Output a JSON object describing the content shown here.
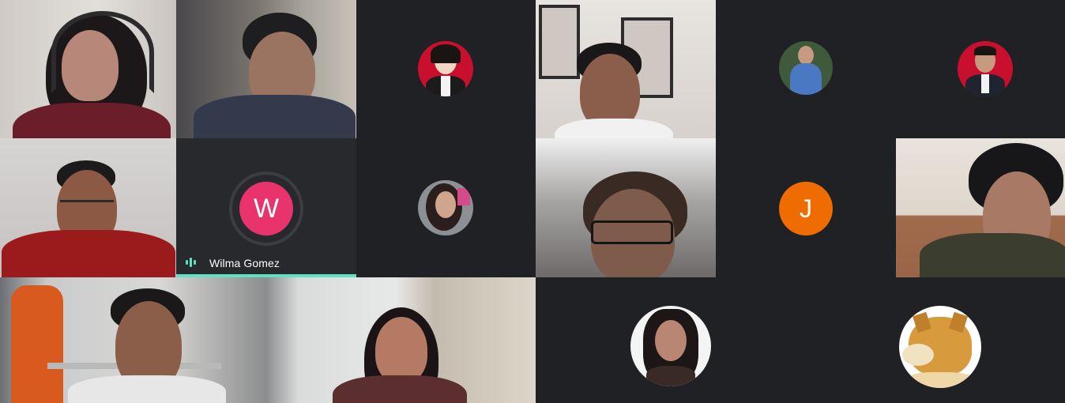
{
  "meeting": {
    "active_speaker": {
      "name": "Wilma Gomez",
      "initial": "W",
      "avatar_color": "#e8336d"
    },
    "participant_initial_j": {
      "initial": "J",
      "avatar_color": "#ee6c00"
    },
    "speaking_accent_color": "#5fe1c4"
  }
}
